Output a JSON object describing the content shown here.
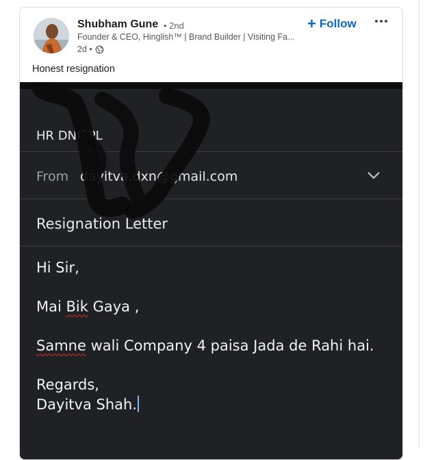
{
  "post": {
    "author_name": "Shubham Gune",
    "degree": "• 2nd",
    "headline": "Founder & CEO, Hinglish™ | Brand Builder | Visiting Fa...",
    "time": "2d •",
    "follow_label": "Follow",
    "follow_icon": "plus-icon",
    "more_icon": "more-horizontal-icon",
    "visibility_icon": "globe-icon",
    "text": "Honest resignation"
  },
  "email": {
    "to": "HR DNISPL",
    "from_label": "From",
    "from_value": "dayitva.dxn@gmail.com",
    "subject": "Resignation Letter",
    "greeting": "Hi Sir,",
    "line1": "Mai Bik Gaya ,",
    "line2": "Samne wali Company 4 paisa Jada de Rahi hai.",
    "closing": "Regards,",
    "signature": "Dayitva Shah."
  },
  "colors": {
    "accent": "#0a66c2",
    "email_bg": "#202124",
    "email_text": "#e8eaed",
    "muted": "#9aa0a6",
    "spellcheck": "#d93025"
  }
}
